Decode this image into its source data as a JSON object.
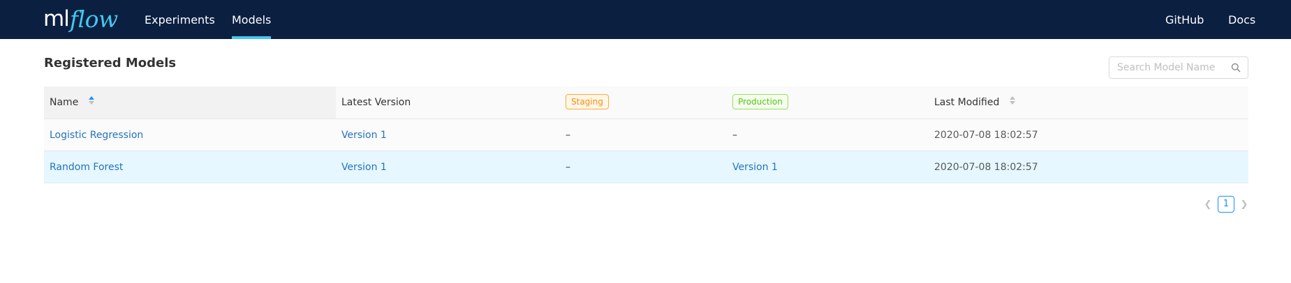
{
  "header": {
    "logo": {
      "ml": "ml",
      "flow": "flow"
    },
    "nav": {
      "experiments": "Experiments",
      "models": "Models",
      "github": "GitHub",
      "docs": "Docs"
    },
    "active_tab": "Models"
  },
  "page": {
    "title": "Registered Models"
  },
  "search": {
    "placeholder": "Search Model Name",
    "value": "",
    "icon": "search-icon"
  },
  "table": {
    "columns": {
      "name": "Name",
      "latest_version": "Latest Version",
      "staging": "Staging",
      "production": "Production",
      "last_modified": "Last Modified"
    },
    "sort": {
      "column": "Name",
      "direction": "ascending"
    },
    "rows": [
      {
        "name": "Logistic Regression",
        "latest_version": "Version 1",
        "staging": "–",
        "production": "–",
        "last_modified": "2020-07-08 18:02:57"
      },
      {
        "name": "Random Forest",
        "latest_version": "Version 1",
        "staging": "–",
        "production": "Version 1",
        "last_modified": "2020-07-08 18:02:57"
      }
    ]
  },
  "pagination": {
    "current_page": "1",
    "prev_icon": "chevron-left-icon",
    "next_icon": "chevron-right-icon"
  },
  "colors": {
    "header_bg": "#0b1f41",
    "accent": "#43c9ed",
    "link": "#2374bb",
    "staging_tag": "#fa8c16",
    "production_tag": "#52c41a",
    "selected_row": "#e6f7ff"
  }
}
